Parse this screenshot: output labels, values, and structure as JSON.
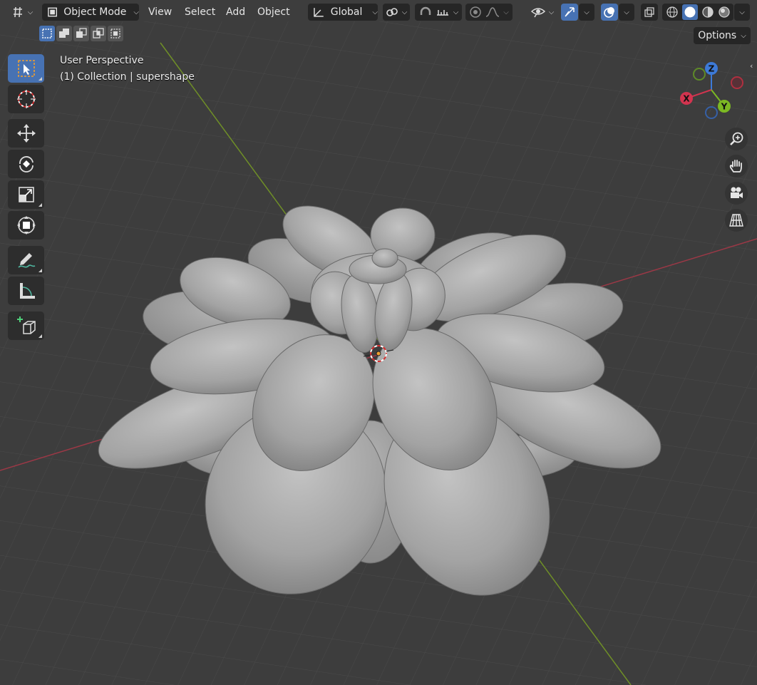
{
  "header": {
    "mode_label": "Object Mode",
    "menus": [
      "View",
      "Select",
      "Add",
      "Object"
    ],
    "orientation_label": "Global"
  },
  "options_label": "Options",
  "overlay": {
    "view_name": "User Perspective",
    "collection_info": "(1) Collection | supershape"
  },
  "gizmo": {
    "x": "X",
    "y": "Y",
    "z": "Z"
  },
  "toolbar": {
    "tools": [
      "select-box",
      "cursor",
      "move",
      "rotate",
      "scale",
      "transform",
      "annotate",
      "measure",
      "add-cube"
    ],
    "active_tool": "select-box"
  },
  "shading": {
    "active_mode": "solid"
  },
  "colors": {
    "accent": "#4772b3",
    "grid_background": "#3d3d3d",
    "x_axis": "#9b3846",
    "y_axis": "#6f8f27",
    "mesh": "#a9a9a9"
  }
}
